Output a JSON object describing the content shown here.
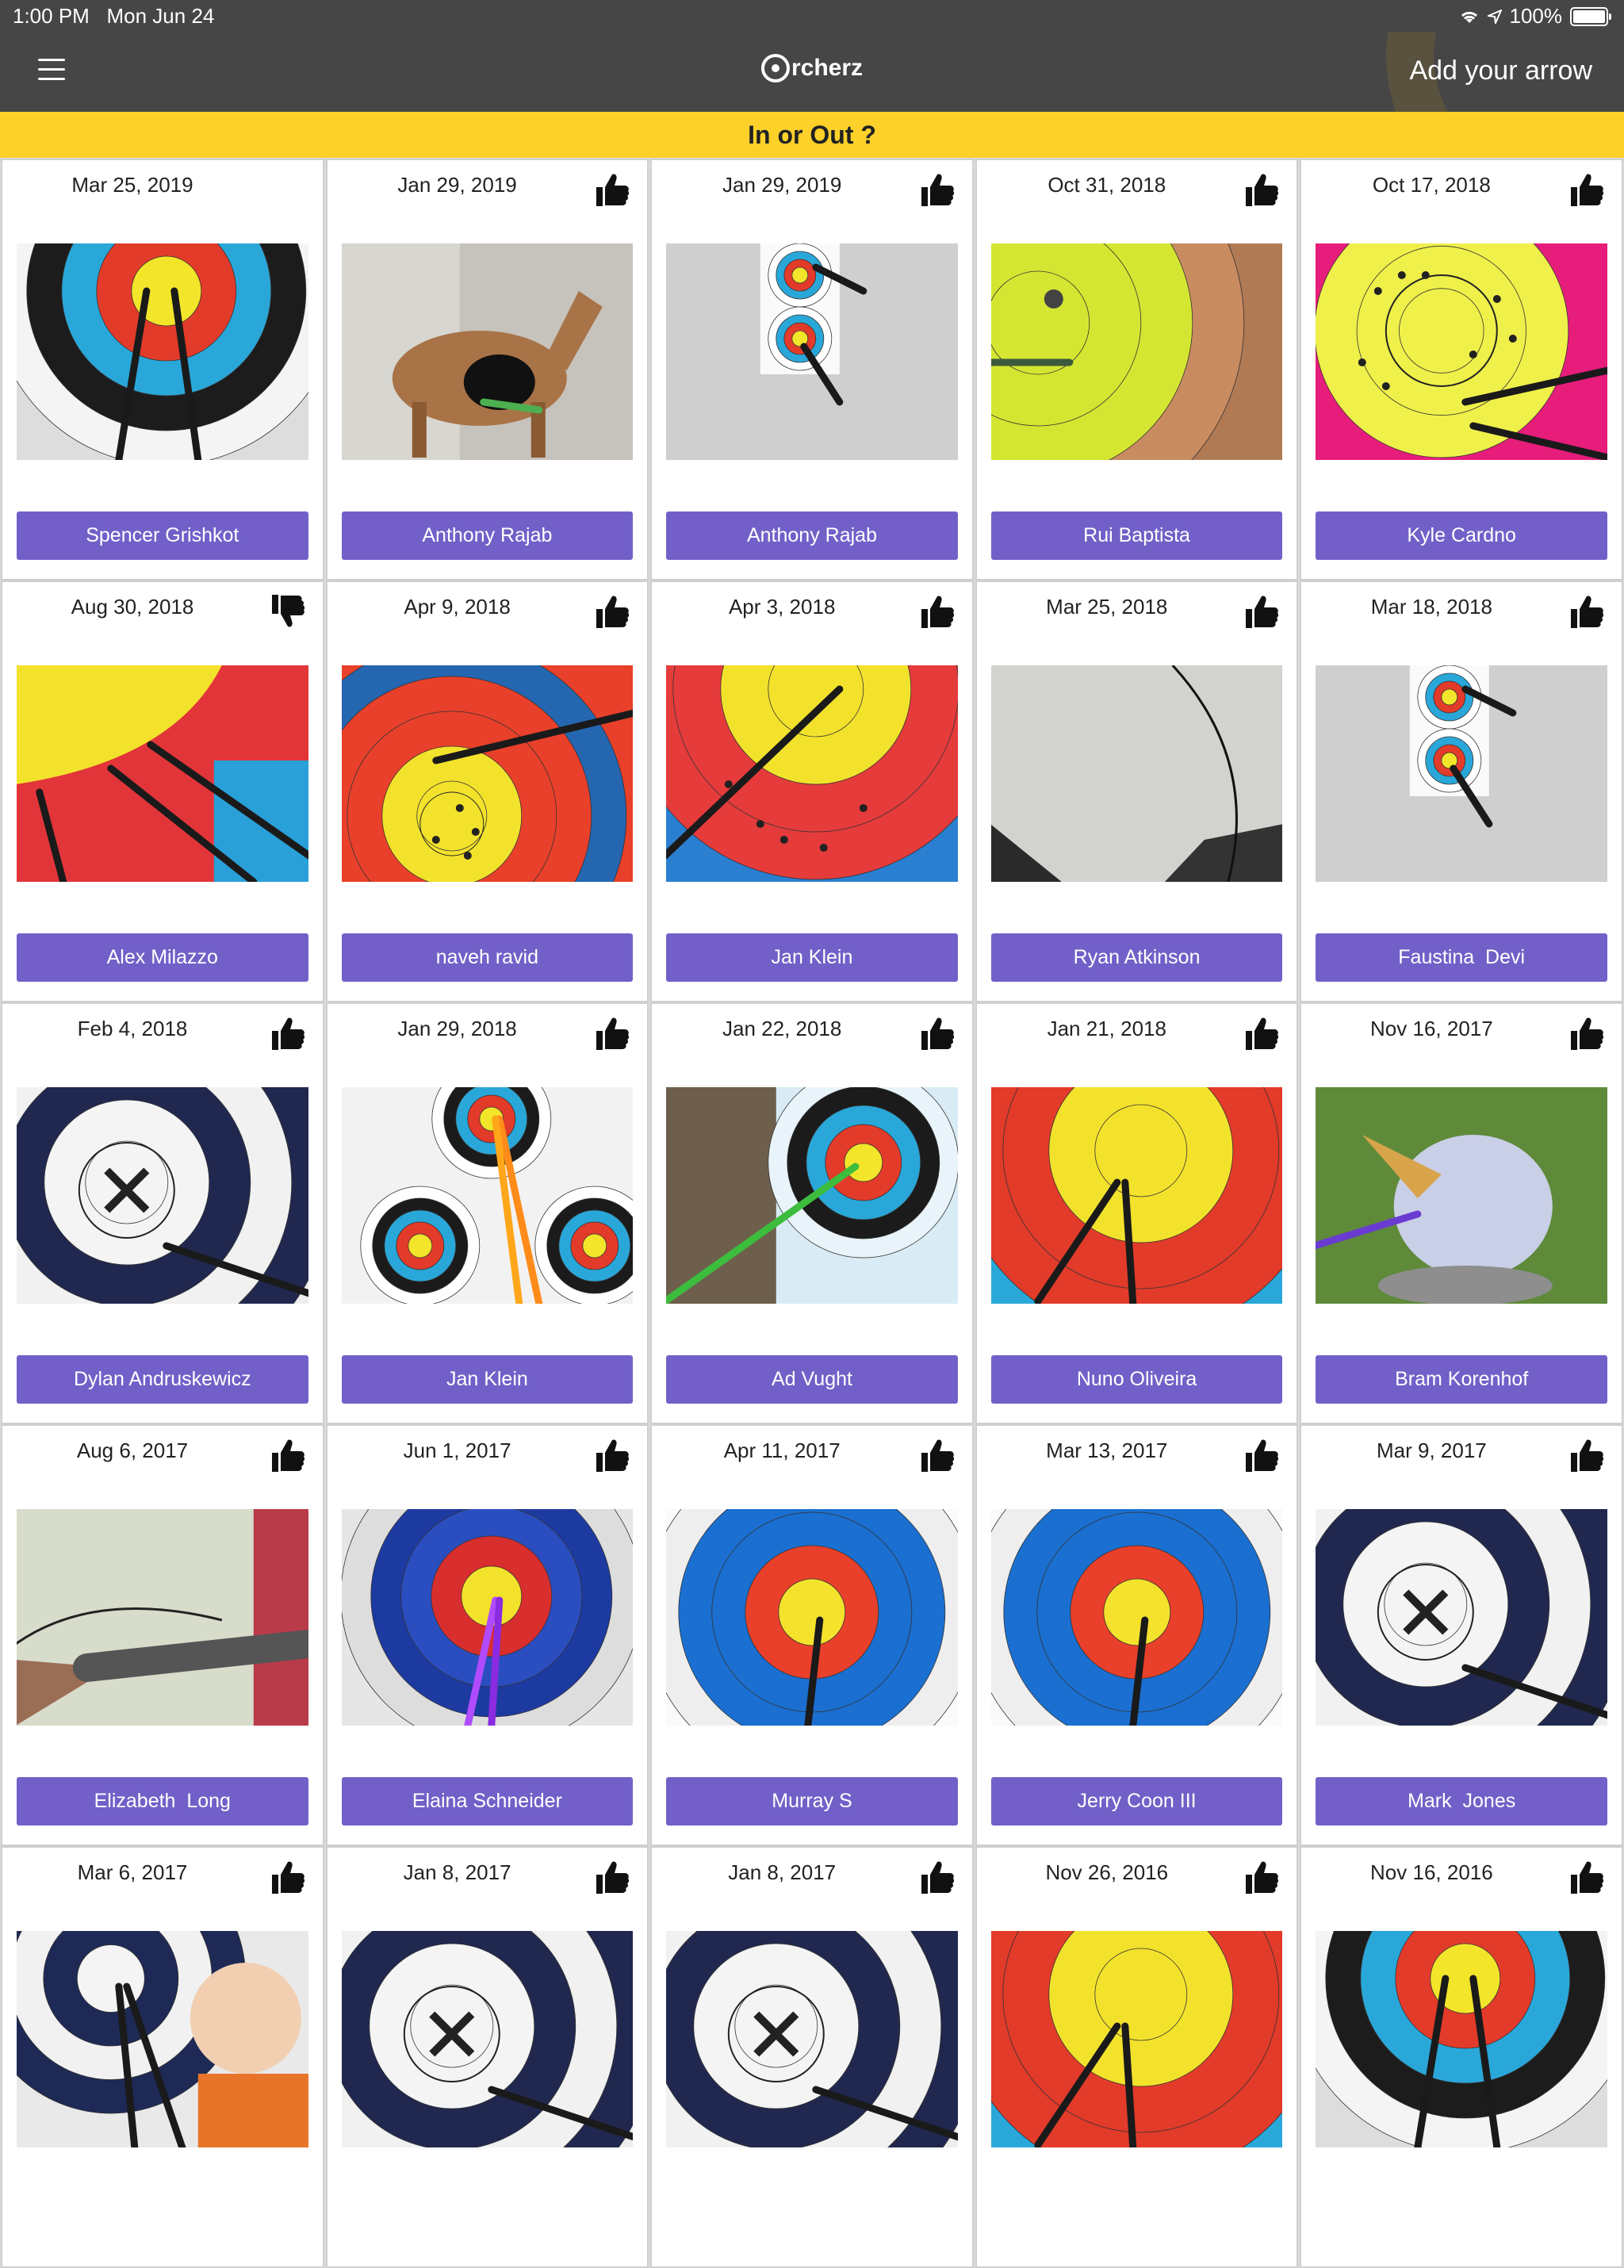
{
  "status": {
    "time": "1:00 PM",
    "date": "Mon Jun 24",
    "battery": "100%"
  },
  "nav": {
    "logo_text": "rcherz",
    "add_label": "Add your arrow"
  },
  "banner": {
    "title": "In or Out ?"
  },
  "colors": {
    "accent": "#7260c8",
    "banner": "#fdd12a",
    "header": "#464646"
  },
  "cards": [
    {
      "date": "Mar 25, 2019",
      "name": "Spencer Grishkot",
      "vote": "none",
      "photo": "target-fita-arrows"
    },
    {
      "date": "Jan 29, 2019",
      "name": "Anthony Rajab",
      "vote": "up",
      "photo": "deer-decoy"
    },
    {
      "date": "Jan 29, 2019",
      "name": "Anthony Rajab",
      "vote": "up",
      "photo": "target-stack"
    },
    {
      "date": "Oct 31, 2018",
      "name": "Rui Baptista",
      "vote": "up",
      "photo": "yellow-closeup"
    },
    {
      "date": "Oct 17, 2018",
      "name": "Kyle Cardno",
      "vote": "up",
      "photo": "yellow-holes"
    },
    {
      "date": "Aug 30, 2018",
      "name": "Alex Milazzo",
      "vote": "down",
      "photo": "gold-arrows"
    },
    {
      "date": "Apr 9, 2018",
      "name": "naveh ravid",
      "vote": "up",
      "photo": "yellow-holes-red"
    },
    {
      "date": "Apr 3, 2018",
      "name": "Jan Klein",
      "vote": "up",
      "photo": "red-holes"
    },
    {
      "date": "Mar 25, 2018",
      "name": "Ryan Atkinson",
      "vote": "up",
      "photo": "gray-closeup"
    },
    {
      "date": "Mar 18, 2018",
      "name": "Faustina  Devi",
      "vote": "up",
      "photo": "target-stack"
    },
    {
      "date": "Feb 4, 2018",
      "name": "Dylan Andruskewicz",
      "vote": "up",
      "photo": "x-center"
    },
    {
      "date": "Jan 29, 2018",
      "name": "Jan Klein",
      "vote": "up",
      "photo": "target-multi"
    },
    {
      "date": "Jan 22, 2018",
      "name": "Ad Vught",
      "vote": "up",
      "photo": "target-wall"
    },
    {
      "date": "Jan 21, 2018",
      "name": "Nuno Oliveira",
      "vote": "up",
      "photo": "yellow-arrows"
    },
    {
      "date": "Nov 16, 2017",
      "name": "Bram Korenhof",
      "vote": "up",
      "photo": "dodo"
    },
    {
      "date": "Aug 6, 2017",
      "name": "Elizabeth  Long",
      "vote": "up",
      "photo": "arrow-closeup"
    },
    {
      "date": "Jun 1, 2017",
      "name": "Elaina Schneider",
      "vote": "up",
      "photo": "target-fita-purple"
    },
    {
      "date": "Apr 11, 2017",
      "name": "Murray S",
      "vote": "up",
      "photo": "target-fita"
    },
    {
      "date": "Mar 13, 2017",
      "name": "Jerry Coon III",
      "vote": "up",
      "photo": "target-fita"
    },
    {
      "date": "Mar 9, 2017",
      "name": "Mark  Jones",
      "vote": "up",
      "photo": "x-center"
    },
    {
      "date": "Mar 6, 2017",
      "name": "",
      "vote": "up",
      "photo": "kid-target"
    },
    {
      "date": "Jan 8, 2017",
      "name": "",
      "vote": "up",
      "photo": "x-center"
    },
    {
      "date": "Jan 8, 2017",
      "name": "",
      "vote": "up",
      "photo": "x-center"
    },
    {
      "date": "Nov 26, 2016",
      "name": "",
      "vote": "up",
      "photo": "yellow-arrows"
    },
    {
      "date": "Nov 16, 2016",
      "name": "",
      "vote": "up",
      "photo": "target-fita-arrows"
    }
  ]
}
